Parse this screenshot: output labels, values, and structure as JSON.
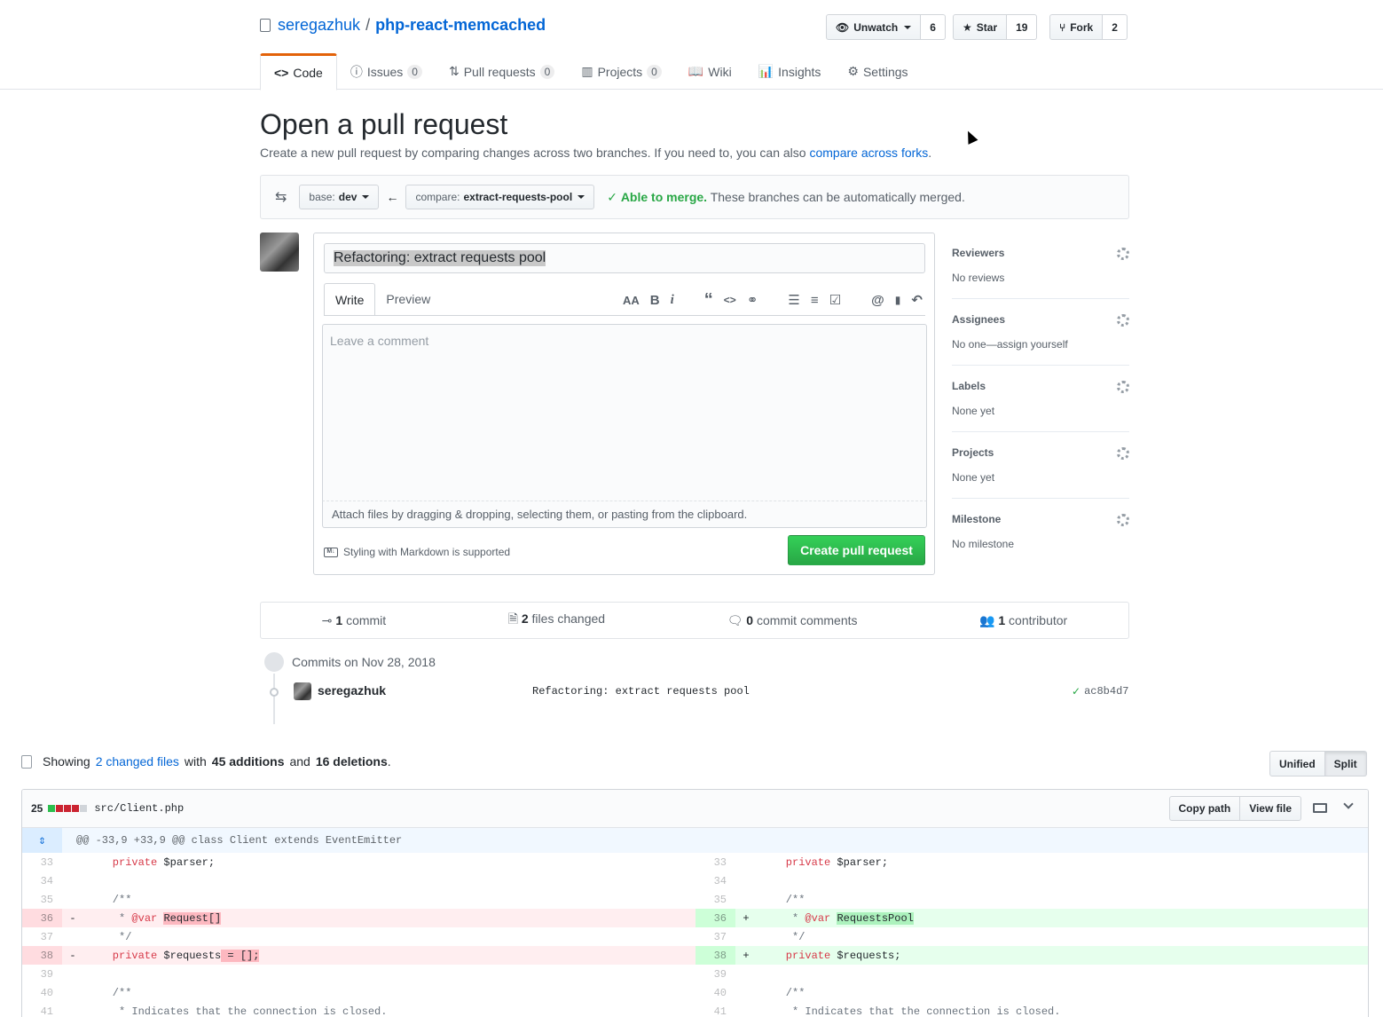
{
  "repo": {
    "owner": "seregazhuk",
    "separator": "/",
    "name": "php-react-memcached"
  },
  "actions": {
    "watch": {
      "label": "Unwatch",
      "count": "6"
    },
    "star": {
      "label": "Star",
      "count": "19"
    },
    "fork": {
      "label": "Fork",
      "count": "2"
    }
  },
  "tabs": [
    {
      "label": "Code",
      "count": ""
    },
    {
      "label": "Issues",
      "count": "0"
    },
    {
      "label": "Pull requests",
      "count": "0"
    },
    {
      "label": "Projects",
      "count": "0"
    },
    {
      "label": "Wiki",
      "count": ""
    },
    {
      "label": "Insights",
      "count": ""
    },
    {
      "label": "Settings",
      "count": ""
    }
  ],
  "page": {
    "title": "Open a pull request",
    "subtitle": "Create a new pull request by comparing changes across two branches. If you need to, you can also",
    "subtitle_link": "compare across forks",
    "subtitle_end": "."
  },
  "range": {
    "base_label": "base:",
    "base_value": "dev",
    "compare_label": "compare:",
    "compare_value": "extract-requests-pool",
    "merge_status": "Able to merge.",
    "merge_detail": "These branches can be automatically merged."
  },
  "composer": {
    "title_value": "Refactoring: extract requests pool",
    "write_tab": "Write",
    "preview_tab": "Preview",
    "comment_placeholder": "Leave a comment",
    "attach_text": "Attach files by dragging & dropping, selecting them, or pasting from the clipboard.",
    "markdown_note": "Styling with Markdown is supported",
    "submit_label": "Create pull request",
    "toolbar": [
      "AA",
      "B",
      "i",
      "“",
      "<>",
      "⚭",
      "☰",
      "≡",
      "☑",
      "@",
      "▮",
      "↶"
    ]
  },
  "sidebar": [
    {
      "heading": "Reviewers",
      "value": "No reviews"
    },
    {
      "heading": "Assignees",
      "value": "No one—assign yourself"
    },
    {
      "heading": "Labels",
      "value": "None yet"
    },
    {
      "heading": "Projects",
      "value": "None yet"
    },
    {
      "heading": "Milestone",
      "value": "No milestone"
    }
  ],
  "summary": {
    "commits_num": "1",
    "commits_label": "commit",
    "files_num": "2",
    "files_label": "files changed",
    "comments_num": "0",
    "comments_label": "commit comments",
    "contrib_num": "1",
    "contrib_label": "contributor"
  },
  "commits": {
    "heading": "Commits on Nov 28, 2018",
    "author": "seregazhuk",
    "message": "Refactoring: extract requests pool",
    "sha": "ac8b4d7"
  },
  "diffstat": {
    "prefix": "Showing",
    "changed_link": "2 changed files",
    "with": "with",
    "additions": "45 additions",
    "and": "and",
    "deletions": "16 deletions",
    "end": ".",
    "unified": "Unified",
    "split": "Split"
  },
  "file": {
    "count": "25",
    "name": "src/Client.php",
    "copy_path": "Copy path",
    "view_file": "View file",
    "hunk": "@@ -33,9 +33,9 @@ class Client extends EventEmitter"
  },
  "colors": {
    "add": "#2cbe4e",
    "del": "#cb2431",
    "neutral": "#d1d5da",
    "accent": "#e36209"
  }
}
